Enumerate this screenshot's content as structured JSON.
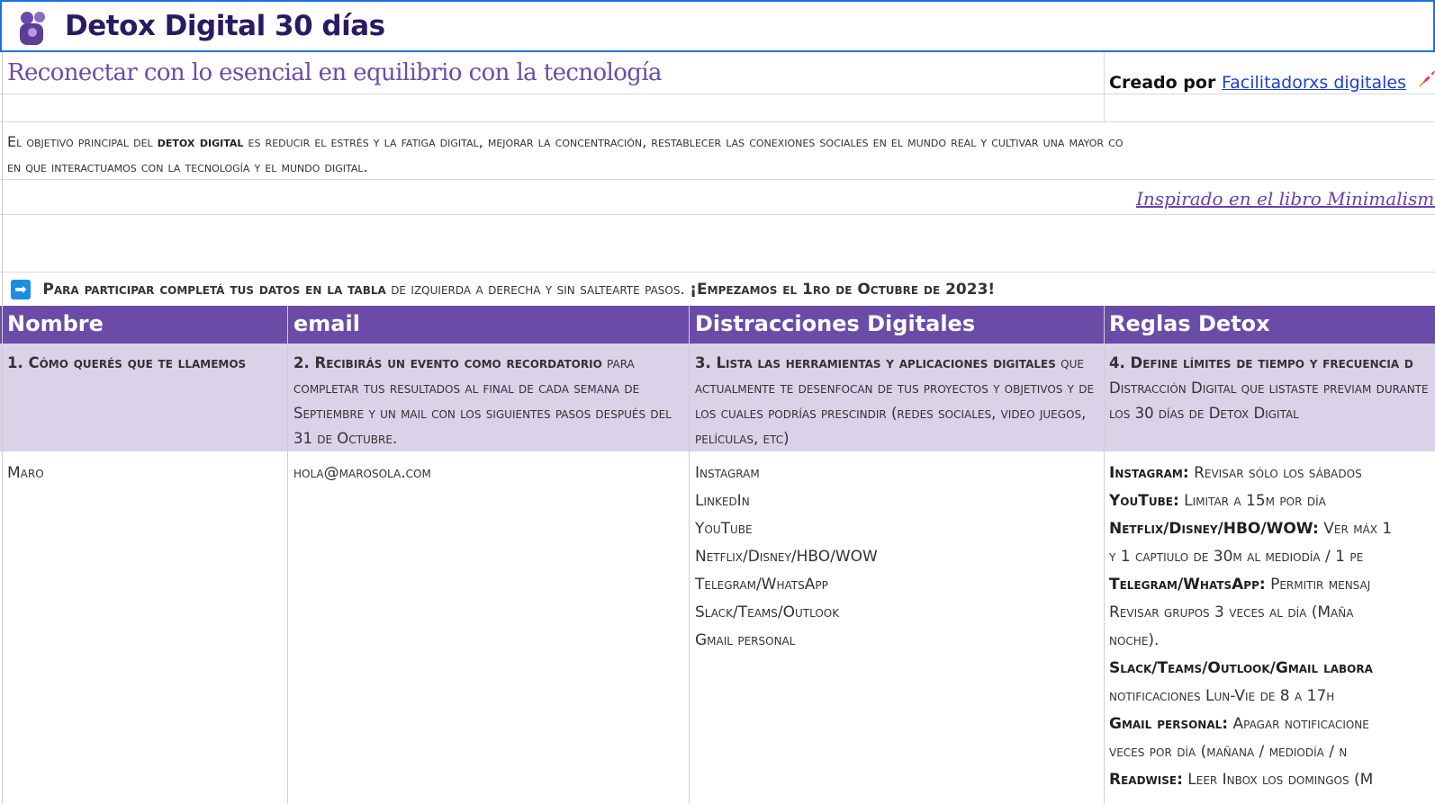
{
  "header": {
    "title": "Detox Digital 30 días",
    "logo_icon": "hands-heart-icon"
  },
  "subtitle": "Reconectar con lo esencial en equilibrio con la tecnología",
  "credits": {
    "prefix": "Creado por",
    "link": "Facilitadorxs digitales",
    "icon": "rocket-icon"
  },
  "objective": {
    "part1": "El objetivo principal del",
    "bold": "detox digital",
    "part2": "es reducir el estrés y la fatiga digital, mejorar la concentración, restablecer las conexiones sociales en el mundo real y cultivar una mayor co",
    "line2": "en que interactuamos con la tecnología y el mundo digital."
  },
  "inspired": "Inspirado en el libro Minimalismo D",
  "participate": {
    "icon": "right-arrow-icon",
    "part1": "Para participar completá tus datos en la tabla",
    "part2": "de izquierda a derecha y sin saltearte pasos.",
    "part3": "¡Empezamos el 1ro de Octubre de 2023!"
  },
  "table": {
    "columns": [
      "Nombre",
      "email",
      "Distracciones Digitales",
      "Reglas Detox"
    ],
    "descriptions": [
      {
        "bold": "1. Cómo querés que te llamemos",
        "rest": ""
      },
      {
        "bold": "2. Recibirás un evento como recordatorio",
        "rest": "para completar tus resultados al final de cada semana de Septiembre y un mail con los siguientes pasos después del 31 de Octubre."
      },
      {
        "bold": "3. Lista las herramientas y aplicaciones digitales",
        "rest": "que actualmente te desenfocan de tus proyectos y objetivos y de los cuales podrías prescindir (redes sociales, video juegos, películas, etc)"
      },
      {
        "bold": "4. Define límites de tiempo y frecuencia d",
        "rest": "Distracción Digital que listaste previam durante los 30 días de Detox Digital"
      }
    ],
    "row": {
      "name": "Maro",
      "email": "hola@marosola.com",
      "distractions": [
        "Instagram",
        "LinkedIn",
        "YouTube",
        "Netflix/Disney/HBO/WOW",
        "Telegram/WhatsApp",
        "Slack/Teams/Outlook",
        "Gmail personal"
      ],
      "rules": [
        {
          "label": "Instagram:",
          "text": "Revisar sólo los sábados"
        },
        {
          "label": "YouTube:",
          "text": " Limitar a 15m por día"
        },
        {
          "label": "Netflix/Disney/HBO/WOW:",
          "text": "Ver máx 1"
        },
        {
          "label": "",
          "text": "y 1 captiulo de 30m al mediodía / 1 pe"
        },
        {
          "label": "Telegram/WhatsApp:",
          "text": "Permitir mensaj"
        },
        {
          "label": "",
          "text": "Revisar grupos 3 veces al día (Maña"
        },
        {
          "label": "",
          "text": "noche)."
        },
        {
          "label": "Slack/Teams/Outlook/Gmail labora",
          "text": ""
        },
        {
          "label": "",
          "text": "notificaciones Lun-Vie de 8 a 17h"
        },
        {
          "label": "Gmail personal:",
          "text": "Apagar notificacione"
        },
        {
          "label": "",
          "text": "veces por día (mañana / mediodía / n"
        },
        {
          "label": "Readwise:",
          "text": "Leer Inbox los domingos (M"
        }
      ]
    }
  },
  "colors": {
    "header_bg": "#6a4ca8",
    "subheader_bg": "#d9d2e9",
    "title": "#2a1a63",
    "accent": "#6a4ca8",
    "link": "#1a3fd1",
    "selection_border": "#1a73e8"
  }
}
